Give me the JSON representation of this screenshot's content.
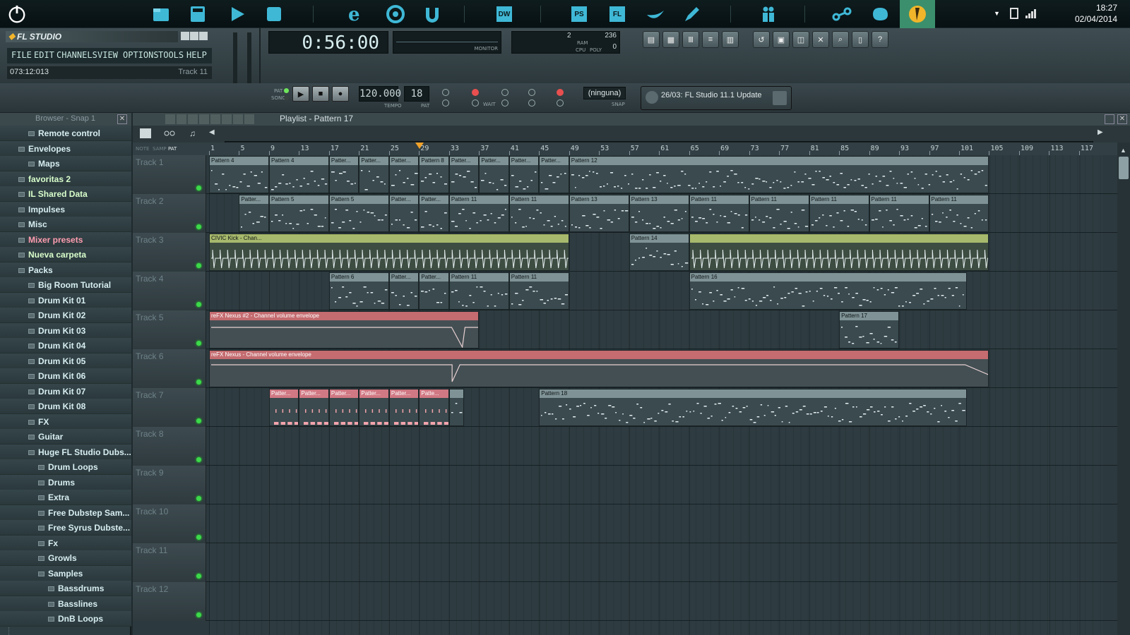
{
  "taskbar": {
    "time": "18:27",
    "date": "02/04/2014",
    "icons": [
      "power-icon",
      "file-manager-icon",
      "calculator-icon",
      "media-player-icon",
      "app-cube-icon",
      "internet-explorer-icon",
      "chrome-icon",
      "utorrent-icon",
      "dreamweaver-icon",
      "photoshop-icon",
      "fl-studio-icon",
      "paper-boat-icon",
      "pen-icon",
      "people-icon",
      "link-icon",
      "cloud-icon",
      "fl-studio-active-icon"
    ],
    "dw_label": "DW",
    "ps_label": "PS",
    "fl_label": "FL"
  },
  "flstudio": {
    "logo": "FL STUDIO",
    "menu": [
      "FILE",
      "EDIT",
      "CHANNELS",
      "VIEW",
      "OPTIONS",
      "TOOLS",
      "HELP"
    ],
    "hint_left": "073:12:013",
    "hint_right": "Track 11",
    "time_display": "0:56:00",
    "monitor_label": "MONITOR",
    "ram_label": "RAM",
    "cpu_label": "CPU",
    "poly_label": "POLY",
    "ram_value": "2",
    "poly_value": "236",
    "poly_value2": "0",
    "tempo": "120.000",
    "tempo_label": "TEMPO",
    "pattern_number": "18",
    "pat_label": "PAT",
    "song_label": "SONG",
    "pat_song_pat": "PAT",
    "wait_label": "WAIT",
    "snap_label": "SNAP",
    "snap_value": "(ninguna)",
    "news": "26/03: FL Studio 11.1 Update"
  },
  "browser": {
    "title": "Browser - Snap 1",
    "items": [
      {
        "label": "Remote control",
        "style": "normal",
        "indent": 1
      },
      {
        "label": "Envelopes",
        "style": "normal",
        "indent": 0
      },
      {
        "label": "Maps",
        "style": "normal",
        "indent": 1
      },
      {
        "label": "favoritas 2",
        "style": "green",
        "indent": 0
      },
      {
        "label": "IL Shared Data",
        "style": "green",
        "indent": 0
      },
      {
        "label": "Impulses",
        "style": "normal",
        "indent": 0
      },
      {
        "label": "Misc",
        "style": "normal",
        "indent": 0
      },
      {
        "label": "Mixer presets",
        "style": "pink",
        "indent": 0
      },
      {
        "label": "Nueva carpeta",
        "style": "green",
        "indent": 0
      },
      {
        "label": "Packs",
        "style": "normal",
        "indent": 0
      },
      {
        "label": "Big Room Tutorial",
        "style": "normal",
        "indent": 1
      },
      {
        "label": "Drum Kit 01",
        "style": "normal",
        "indent": 1
      },
      {
        "label": "Drum Kit 02",
        "style": "normal",
        "indent": 1
      },
      {
        "label": "Drum Kit 03",
        "style": "normal",
        "indent": 1
      },
      {
        "label": "Drum Kit 04",
        "style": "normal",
        "indent": 1
      },
      {
        "label": "Drum Kit 05",
        "style": "normal",
        "indent": 1
      },
      {
        "label": "Drum Kit 06",
        "style": "normal",
        "indent": 1
      },
      {
        "label": "Drum Kit 07",
        "style": "normal",
        "indent": 1
      },
      {
        "label": "Drum Kit 08",
        "style": "normal",
        "indent": 1
      },
      {
        "label": "FX",
        "style": "normal",
        "indent": 1
      },
      {
        "label": "Guitar",
        "style": "normal",
        "indent": 1
      },
      {
        "label": "Huge FL Studio Dubs...",
        "style": "normal",
        "indent": 1
      },
      {
        "label": "Drum Loops",
        "style": "normal",
        "indent": 2
      },
      {
        "label": "Drums",
        "style": "normal",
        "indent": 2
      },
      {
        "label": "Extra",
        "style": "normal",
        "indent": 2
      },
      {
        "label": "Free Dubstep Sam...",
        "style": "normal",
        "indent": 2
      },
      {
        "label": "Free Syrus Dubste...",
        "style": "normal",
        "indent": 2
      },
      {
        "label": "Fx",
        "style": "normal",
        "indent": 2
      },
      {
        "label": "Growls",
        "style": "normal",
        "indent": 2
      },
      {
        "label": "Samples",
        "style": "normal",
        "indent": 2
      },
      {
        "label": "Bassdrums",
        "style": "normal",
        "indent": 3
      },
      {
        "label": "Basslines",
        "style": "normal",
        "indent": 3
      },
      {
        "label": "DnB Loops",
        "style": "normal",
        "indent": 3
      }
    ]
  },
  "playlist": {
    "title": "Playlist - Pattern 17",
    "toolbar_labels": [
      "NOTE",
      "SAMP",
      "PAT"
    ],
    "ruler": [
      "1",
      "5",
      "9",
      "13",
      "17",
      "21",
      "25",
      "29",
      "33",
      "37",
      "41",
      "45",
      "49",
      "53",
      "57",
      "61",
      "65",
      "69",
      "73",
      "77",
      "81",
      "85",
      "89",
      "93",
      "97",
      "101",
      "105",
      "109",
      "113",
      "117"
    ],
    "tracks": [
      "Track 1",
      "Track 2",
      "Track 3",
      "Track 4",
      "Track 5",
      "Track 6",
      "Track 7",
      "Track 8",
      "Track 9",
      "Track 10",
      "Track 11",
      "Track 12"
    ],
    "clips": [
      {
        "track": 0,
        "start": 1,
        "end": 9,
        "label": "Pattern 4",
        "kind": "pattern"
      },
      {
        "track": 0,
        "start": 9,
        "end": 17,
        "label": "Pattern 4",
        "kind": "pattern"
      },
      {
        "track": 0,
        "start": 17,
        "end": 21,
        "label": "Patter...",
        "kind": "pattern"
      },
      {
        "track": 0,
        "start": 21,
        "end": 25,
        "label": "Patter...",
        "kind": "pattern"
      },
      {
        "track": 0,
        "start": 25,
        "end": 29,
        "label": "Patter...",
        "kind": "pattern"
      },
      {
        "track": 0,
        "start": 29,
        "end": 33,
        "label": "Pattern 8",
        "kind": "pattern"
      },
      {
        "track": 0,
        "start": 33,
        "end": 37,
        "label": "Patter...",
        "kind": "pattern"
      },
      {
        "track": 0,
        "start": 37,
        "end": 41,
        "label": "Patter...",
        "kind": "pattern"
      },
      {
        "track": 0,
        "start": 41,
        "end": 45,
        "label": "Patter...",
        "kind": "pattern"
      },
      {
        "track": 0,
        "start": 45,
        "end": 49,
        "label": "Patter...",
        "kind": "pattern"
      },
      {
        "track": 0,
        "start": 49,
        "end": 105,
        "label": "Pattern 12",
        "kind": "pattern"
      },
      {
        "track": 1,
        "start": 5,
        "end": 9,
        "label": "Patter...",
        "kind": "pattern"
      },
      {
        "track": 1,
        "start": 9,
        "end": 17,
        "label": "Pattern 5",
        "kind": "pattern"
      },
      {
        "track": 1,
        "start": 17,
        "end": 25,
        "label": "Pattern 5",
        "kind": "pattern"
      },
      {
        "track": 1,
        "start": 25,
        "end": 29,
        "label": "Patter...",
        "kind": "pattern"
      },
      {
        "track": 1,
        "start": 29,
        "end": 33,
        "label": "Patter...",
        "kind": "pattern"
      },
      {
        "track": 1,
        "start": 33,
        "end": 41,
        "label": "Pattern 11",
        "kind": "pattern"
      },
      {
        "track": 1,
        "start": 41,
        "end": 49,
        "label": "Pattern 11",
        "kind": "pattern"
      },
      {
        "track": 1,
        "start": 49,
        "end": 57,
        "label": "Pattern 13",
        "kind": "pattern"
      },
      {
        "track": 1,
        "start": 57,
        "end": 65,
        "label": "Pattern 13",
        "kind": "pattern"
      },
      {
        "track": 1,
        "start": 65,
        "end": 73,
        "label": "Pattern 11",
        "kind": "pattern"
      },
      {
        "track": 1,
        "start": 73,
        "end": 81,
        "label": "Pattern 11",
        "kind": "pattern"
      },
      {
        "track": 1,
        "start": 81,
        "end": 89,
        "label": "Pattern 11",
        "kind": "pattern"
      },
      {
        "track": 1,
        "start": 89,
        "end": 97,
        "label": "Pattern 11",
        "kind": "pattern"
      },
      {
        "track": 1,
        "start": 97,
        "end": 105,
        "label": "Pattern 11",
        "kind": "pattern"
      },
      {
        "track": 2,
        "start": 1,
        "end": 49,
        "label": "CIVIC Kick - Chan...",
        "kind": "kick"
      },
      {
        "track": 2,
        "start": 57,
        "end": 65,
        "label": "Pattern 14",
        "kind": "pattern"
      },
      {
        "track": 2,
        "start": 65,
        "end": 105,
        "label": "",
        "kind": "kick"
      },
      {
        "track": 3,
        "start": 17,
        "end": 25,
        "label": "Pattern 6",
        "kind": "pattern"
      },
      {
        "track": 3,
        "start": 25,
        "end": 29,
        "label": "Patter...",
        "kind": "pattern"
      },
      {
        "track": 3,
        "start": 29,
        "end": 33,
        "label": "Patter...",
        "kind": "pattern"
      },
      {
        "track": 3,
        "start": 33,
        "end": 41,
        "label": "Pattern 11",
        "kind": "pattern"
      },
      {
        "track": 3,
        "start": 41,
        "end": 49,
        "label": "Pattern 11",
        "kind": "pattern"
      },
      {
        "track": 3,
        "start": 65,
        "end": 102,
        "label": "Pattern 16",
        "kind": "pattern"
      },
      {
        "track": 4,
        "start": 1,
        "end": 37,
        "label": "reFX Nexus #2 - Channel volume envelope",
        "kind": "env"
      },
      {
        "track": 4,
        "start": 85,
        "end": 93,
        "label": "Pattern 17",
        "kind": "pattern"
      },
      {
        "track": 5,
        "start": 1,
        "end": 105,
        "label": "reFX Nexus - Channel volume envelope",
        "kind": "env"
      },
      {
        "track": 6,
        "start": 9,
        "end": 13,
        "label": "Patter...",
        "kind": "pink"
      },
      {
        "track": 6,
        "start": 13,
        "end": 17,
        "label": "Patter...",
        "kind": "pink"
      },
      {
        "track": 6,
        "start": 17,
        "end": 21,
        "label": "Patter...",
        "kind": "pink"
      },
      {
        "track": 6,
        "start": 21,
        "end": 25,
        "label": "Patter...",
        "kind": "pink"
      },
      {
        "track": 6,
        "start": 25,
        "end": 29,
        "label": "Patter...",
        "kind": "pink"
      },
      {
        "track": 6,
        "start": 29,
        "end": 33,
        "label": "Patte...",
        "kind": "pink"
      },
      {
        "track": 6,
        "start": 33,
        "end": 35,
        "label": "",
        "kind": "pattern"
      },
      {
        "track": 6,
        "start": 45,
        "end": 102,
        "label": "Pattern 18",
        "kind": "pattern"
      }
    ]
  },
  "colors": {
    "accent_green": "#3cd94a",
    "kick_header": "#a7b96c",
    "envelope_header": "#c46c70",
    "pink_header": "#d07883"
  }
}
